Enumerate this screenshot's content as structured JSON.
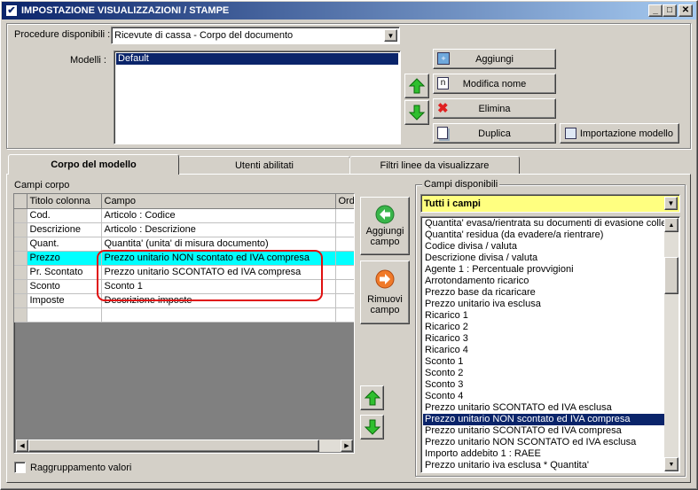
{
  "window": {
    "title": "IMPOSTAZIONE VISUALIZZAZIONI / STAMPE",
    "min": "_",
    "max": "□",
    "close": "✕"
  },
  "top": {
    "procedure_label": "Procedure disponibili :",
    "procedure_value": "Ricevute di cassa - Corpo del documento",
    "modelli_label": "Modelli :",
    "modelli": [
      "Default"
    ],
    "buttons": {
      "aggiungi": "Aggiungi",
      "modifica": "Modifica nome",
      "elimina": "Elimina",
      "duplica": "Duplica",
      "importazione": "Importazione modello"
    }
  },
  "tabs": [
    "Corpo del modello",
    "Utenti abilitati",
    "Filtri linee da visualizzare"
  ],
  "campi_corpo": {
    "label": "Campi corpo",
    "headers": [
      "Titolo colonna",
      "Campo",
      "Ordi"
    ],
    "rows": [
      {
        "titolo": "Cod.",
        "campo": "Articolo : Codice"
      },
      {
        "titolo": "Descrizione",
        "campo": "Articolo : Descrizione"
      },
      {
        "titolo": "Quant.",
        "campo": "Quantita' (unita' di misura documento)"
      },
      {
        "titolo": "Prezzo",
        "campo": "Prezzo unitario NON scontato ed IVA compresa"
      },
      {
        "titolo": "Pr. Scontato",
        "campo": "Prezzo unitario SCONTATO ed IVA compresa"
      },
      {
        "titolo": "Sconto",
        "campo": "Sconto 1"
      },
      {
        "titolo": "Imposte",
        "campo": "Descrizione imposte"
      }
    ]
  },
  "middle_buttons": {
    "aggiungi_campo": [
      "Aggiungi",
      "campo"
    ],
    "rimuovi_campo": [
      "Rimuovi",
      "campo"
    ]
  },
  "raggruppamento": "Raggruppamento valori",
  "campi_disponibili": {
    "label": "Campi disponibili",
    "filter": "Tutti i campi",
    "items": [
      "Quantita' evasa/rientrata su documenti di evasione collega",
      "Quantita' residua (da evadere/a rientrare)",
      "Codice divisa / valuta",
      "Descrizione divisa / valuta",
      "Agente 1 : Percentuale provvigioni",
      "Arrotondamento ricarico",
      "Prezzo base da ricaricare",
      "Prezzo unitario iva esclusa",
      "Ricarico 1",
      "Ricarico 2",
      "Ricarico 3",
      "Ricarico 4",
      "Sconto 1",
      "Sconto 2",
      "Sconto 3",
      "Sconto 4",
      "Prezzo unitario SCONTATO ed IVA esclusa",
      "Prezzo unitario NON scontato ed IVA compresa",
      "Prezzo unitario SCONTATO ed IVA compresa",
      "Prezzo unitario NON SCONTATO ed IVA esclusa",
      "Importo addebito 1 : RAEE",
      "Prezzo unitario iva esclusa * Quantita'"
    ],
    "selected_index": 17
  },
  "colors": {
    "highlight_row": "#00ffff",
    "annotation": "#e01010",
    "filter_bg": "#ffff80",
    "selection": "#0a246a"
  }
}
